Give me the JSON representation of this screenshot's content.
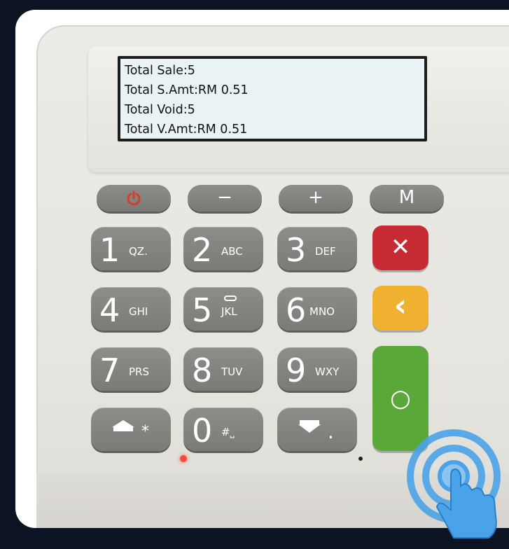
{
  "screen": {
    "lines": [
      "Total Sale:5",
      "Total S.Amt:RM 0.51",
      "Total Void:5",
      "Total V.Amt:RM 0.51"
    ]
  },
  "function_keys": {
    "power_icon": "power-icon",
    "minus": "−",
    "plus": "+",
    "menu": "M"
  },
  "keypad": {
    "k1": {
      "num": "1",
      "sub": "QZ."
    },
    "k2": {
      "num": "2",
      "sub": "ABC"
    },
    "k3": {
      "num": "3",
      "sub": "DEF"
    },
    "k4": {
      "num": "4",
      "sub": "GHI"
    },
    "k5": {
      "num": "5",
      "sub": "JKL"
    },
    "k6": {
      "num": "6",
      "sub": "MNO"
    },
    "k7": {
      "num": "7",
      "sub": "PRS"
    },
    "k8": {
      "num": "8",
      "sub": "TUV"
    },
    "k9": {
      "num": "9",
      "sub": "WXY"
    },
    "k0": {
      "num": "0",
      "sub": "#⎵"
    },
    "up_sub": "*",
    "down_sub": "."
  },
  "action_keys": {
    "cancel": "✕",
    "back": "‹",
    "enter": "○"
  },
  "colors": {
    "cancel": "#c62a32",
    "back": "#f0b030",
    "enter": "#5aa83a",
    "tap_icon": "#4aa3e8"
  }
}
